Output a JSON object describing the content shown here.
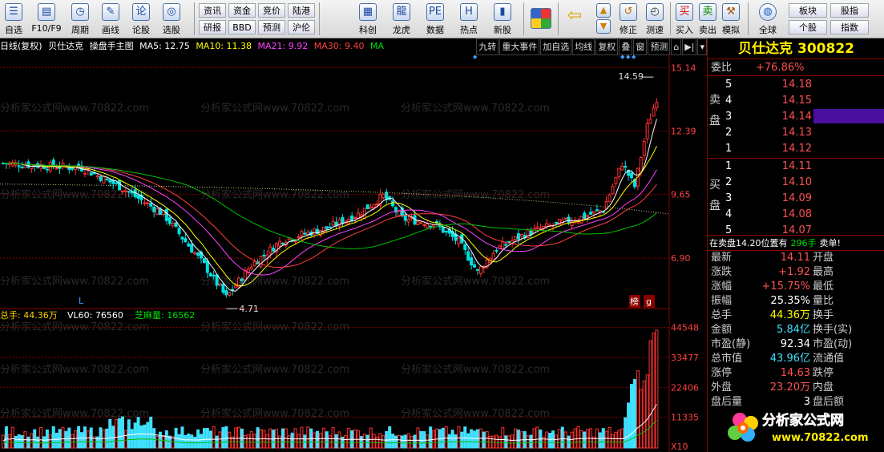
{
  "toolbar": {
    "tools": [
      {
        "name": "self-select",
        "icon": "list",
        "label": "自选"
      },
      {
        "name": "f10",
        "icon": "doc",
        "label": "F10/F9"
      },
      {
        "name": "period",
        "icon": "clock",
        "label": "周期"
      },
      {
        "name": "draw",
        "icon": "pen",
        "label": "画线"
      },
      {
        "name": "stock-forum",
        "icon": "论",
        "label": "论股"
      },
      {
        "name": "pick",
        "icon": "target",
        "label": "选股"
      }
    ],
    "grid": [
      "资讯",
      "资金",
      "竞价",
      "陆港",
      "研报",
      "BBD",
      "预测",
      "沪伦"
    ],
    "tools2": [
      {
        "name": "science",
        "icon": "chart",
        "label": "科创"
      },
      {
        "name": "dragon",
        "icon": "dragon",
        "label": "龙虎"
      },
      {
        "name": "data",
        "icon": "PE",
        "label": "数据"
      },
      {
        "name": "hot",
        "icon": "HOT",
        "label": "热点"
      },
      {
        "name": "new-stock",
        "icon": "new",
        "label": "新股"
      }
    ],
    "tools3": [
      {
        "name": "back",
        "label": ""
      },
      {
        "name": "modify",
        "label": "修正"
      },
      {
        "name": "test",
        "label": "测速"
      }
    ],
    "trade": [
      {
        "icon": "买",
        "label": "买入"
      },
      {
        "icon": "卖",
        "label": "卖出"
      },
      {
        "icon": "hammer",
        "label": "模拟"
      }
    ],
    "global": {
      "label": "全球"
    },
    "grid2": [
      "板块",
      "股指",
      "个股",
      "指数"
    ]
  },
  "chart": {
    "title": "日线(复权)",
    "name": "贝仕达克",
    "template": "操盘手主图",
    "ma5": "MA5: 12.75",
    "ma10": "MA10: 11.38",
    "ma21": "MA21: 9.92",
    "ma30": "MA30: 9.40",
    "ma_extra": "MA",
    "buttons": [
      "九转",
      "重大事件",
      "加自选",
      "均线",
      "复权",
      "叠",
      "窗",
      "预测"
    ],
    "yticks": [
      "15.14",
      "12.39",
      "9.65",
      "6.90"
    ],
    "high_label": "14.59",
    "low_label": "4.71",
    "marker_l": "L",
    "tag1": "榜",
    "tag2": "g",
    "watermark": "分析家公式网www.70822.com",
    "vol_label": "总手: 44.36万",
    "vl60": "VL60: 76560",
    "sesame": "芝麻量: 16562",
    "vol_yticks": [
      "44548",
      "33477",
      "22406",
      "11335"
    ],
    "vol_unit": "X10",
    "colors": {
      "up": "#ff3030",
      "down": "#00e0e0",
      "bg": "#000000",
      "grid": "#8b0000"
    }
  },
  "chart_data": {
    "type": "candlestick",
    "price_ticks": [
      15.14,
      12.39,
      9.65,
      6.9
    ],
    "high": 14.59,
    "low": 4.71,
    "volume_ticks": [
      44548,
      33477,
      22406,
      11335
    ]
  },
  "panel": {
    "name": "贝仕达克",
    "code": "300822",
    "weibi_label": "委比",
    "weibi": "+76.86%",
    "sell_label": "卖盘",
    "buy_label": "买盘",
    "sells": [
      {
        "n": "5",
        "p": "14.18"
      },
      {
        "n": "4",
        "p": "14.15"
      },
      {
        "n": "3",
        "p": "14.14"
      },
      {
        "n": "2",
        "p": "14.13"
      },
      {
        "n": "1",
        "p": "14.12"
      }
    ],
    "buys": [
      {
        "n": "1",
        "p": "14.11"
      },
      {
        "n": "2",
        "p": "14.10"
      },
      {
        "n": "3",
        "p": "14.09"
      },
      {
        "n": "4",
        "p": "14.08"
      },
      {
        "n": "5",
        "p": "14.07"
      }
    ],
    "notice": "在卖盘14.20位置有",
    "notice_qty": "296手",
    "notice_tail": "卖单!",
    "stats": [
      {
        "l": "最新",
        "v": "14.11",
        "r": "开盘",
        "c": "red"
      },
      {
        "l": "涨跌",
        "v": "+1.92",
        "r": "最高",
        "c": "red"
      },
      {
        "l": "涨幅",
        "v": "+15.75%",
        "r": "最低",
        "c": "red"
      },
      {
        "l": "振幅",
        "v": "25.35%",
        "r": "量比",
        "c": "white"
      },
      {
        "l": "总手",
        "v": "44.36万",
        "r": "换手",
        "c": "yel"
      },
      {
        "l": "金额",
        "v": "5.84亿",
        "r": "换手(实)",
        "c": "cyan"
      },
      {
        "l": "市盈(静)",
        "v": "92.34",
        "r": "市盈(动)",
        "c": "white"
      },
      {
        "l": "总市值",
        "v": "43.96亿",
        "r": "流通值",
        "c": "cyan"
      },
      {
        "l": "涨停",
        "v": "14.63",
        "r": "跌停",
        "c": "red"
      },
      {
        "l": "外盘",
        "v": "23.20万",
        "r": "内盘",
        "c": "red"
      },
      {
        "l": "盘后量",
        "v": "3",
        "r": "盘后额",
        "c": "white"
      }
    ],
    "watermark_title": "分析家公式网",
    "watermark_url": "www.70822.com"
  }
}
